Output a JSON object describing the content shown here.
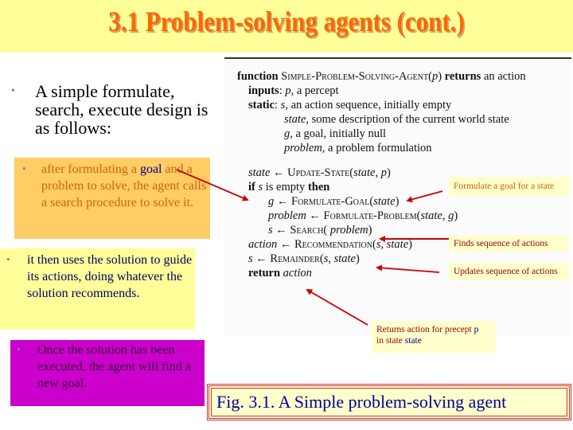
{
  "slide": {
    "title": "3.1 Problem-solving agents (cont.)",
    "main_bullet": "A simple formulate, search, execute design is as follows:",
    "bullet_marker": "•",
    "sub_bullets": {
      "formulate": {
        "before": "after formulating a ",
        "highlight": "goal",
        "after": " and a problem to solve, the agent calls a search procedure to solve it."
      },
      "execute": "it then uses the solution to guide its actions, doing whatever the solution recommends.",
      "new_goal": "Once the solution has been executed, the agent will find a new goal."
    },
    "colors": {
      "title": "#ff6600",
      "title_bar": "#ffff99",
      "orange_box": "#ffcc66",
      "yellow_box": "#ffff99",
      "magenta_box": "#cc00cc",
      "arrow": "#cc0000",
      "caption_text": "#000099",
      "caption_border": "#cc3333"
    }
  },
  "algorithm": {
    "header": {
      "kw_function": "function",
      "name": "Simple-Problem-Solving-Agent",
      "param": "p",
      "kw_returns": "returns",
      "rest": "an action"
    },
    "inputs": {
      "kw": "inputs",
      "var": "p",
      "desc": ", a percept"
    },
    "static": [
      {
        "kw": "static",
        "var": "s",
        "desc": ", an action sequence, initially empty"
      },
      {
        "var": "state",
        "desc": ", some description of the current world state"
      },
      {
        "var": "g",
        "desc": ", a goal, initially null"
      },
      {
        "var": "problem",
        "desc": ", a problem formulation"
      }
    ],
    "body": {
      "update": {
        "lhs": "state",
        "arrow": "←",
        "fn": "Update-State",
        "args": "state, p"
      },
      "if": {
        "kw_if": "if",
        "var": "s",
        "mid": "is empty",
        "kw_then": "then"
      },
      "formulate_goal": {
        "lhs": "g",
        "arrow": "←",
        "fn": "Formulate-Goal",
        "args": "state"
      },
      "formulate_problem": {
        "lhs": "problem",
        "arrow": "←",
        "fn": "Formulate-Problem",
        "args": "state, g"
      },
      "search": {
        "lhs": "s",
        "arrow": "←",
        "fn": "Search",
        "args": "problem"
      },
      "recommend": {
        "lhs": "action",
        "arrow": "←",
        "fn": "Recommendation",
        "args": "s, state"
      },
      "remainder": {
        "lhs": "s",
        "arrow": "←",
        "fn": "Remainder",
        "args": "s, state"
      },
      "return": {
        "kw": "return",
        "var": "action"
      }
    }
  },
  "annotations": {
    "formulate": "Formulate a goal for a state",
    "finds": "Finds sequence of actions",
    "updates": "Updates sequence of actions",
    "returns_pre": "Returns action for precept ",
    "returns_p": "p",
    "returns_mid": "in state ",
    "returns_state": "state"
  },
  "caption": "Fig. 3.1. A Simple problem-solving agent"
}
